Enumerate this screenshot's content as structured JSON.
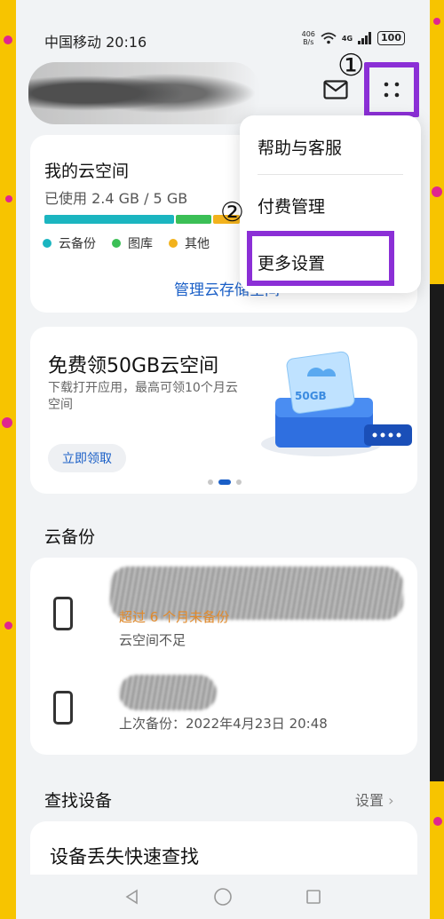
{
  "status_bar": {
    "carrier_time": "中国移动 20:16",
    "net_speed_top": "406",
    "net_speed_bottom": "B/s",
    "signal": "4G",
    "battery": "100"
  },
  "annotations": {
    "step1": "①",
    "step2": "②"
  },
  "header": {
    "mail_icon": "mail-icon",
    "more_icon": "more-dots-icon"
  },
  "menu": {
    "items": [
      {
        "label": "帮助与客服"
      },
      {
        "label": "付费管理"
      },
      {
        "label": "更多设置"
      }
    ]
  },
  "storage": {
    "title": "我的云空间",
    "used": "已使用 2.4 GB / 5 GB",
    "usage_fraction": 0.48,
    "legend": [
      {
        "label": "云备份",
        "color": "#1bb5c0"
      },
      {
        "label": "图库",
        "color": "#3bbf56"
      },
      {
        "label": "其他",
        "color": "#f2b21c"
      }
    ],
    "manage_link": "管理云存储空间"
  },
  "promo": {
    "title": "免费领50GB云空间",
    "desc": "下载打开应用，最高可领10个月云空间",
    "button": "立即领取",
    "badge": "50GB"
  },
  "backup": {
    "section_title": "云备份",
    "warning": "超过 6 个月未备份",
    "warning_sub": "云空间不足",
    "last_backup": "上次备份：2022年4月23日 20:48"
  },
  "find": {
    "section_title": "查找设备",
    "settings": "设置",
    "card_title": "设备丢失快速查找"
  },
  "colors": {
    "accent": "#1a5fc7",
    "annotation_box": "#8b2fd6",
    "frame": "#f7c400"
  }
}
